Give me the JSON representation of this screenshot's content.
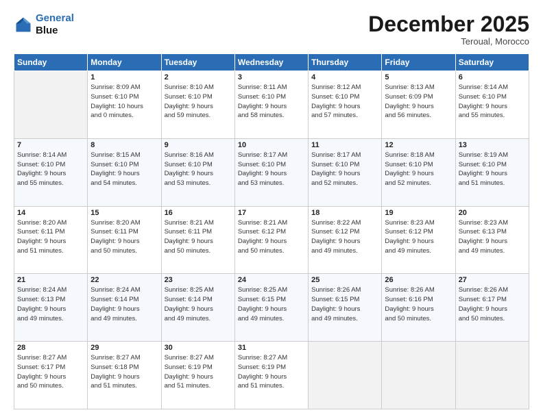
{
  "header": {
    "logo_line1": "General",
    "logo_line2": "Blue",
    "month": "December 2025",
    "location": "Teroual, Morocco"
  },
  "weekdays": [
    "Sunday",
    "Monday",
    "Tuesday",
    "Wednesday",
    "Thursday",
    "Friday",
    "Saturday"
  ],
  "weeks": [
    [
      {
        "day": "",
        "sunrise": "",
        "sunset": "",
        "daylight": ""
      },
      {
        "day": "1",
        "sunrise": "Sunrise: 8:09 AM",
        "sunset": "Sunset: 6:10 PM",
        "daylight": "Daylight: 10 hours and 0 minutes."
      },
      {
        "day": "2",
        "sunrise": "Sunrise: 8:10 AM",
        "sunset": "Sunset: 6:10 PM",
        "daylight": "Daylight: 9 hours and 59 minutes."
      },
      {
        "day": "3",
        "sunrise": "Sunrise: 8:11 AM",
        "sunset": "Sunset: 6:10 PM",
        "daylight": "Daylight: 9 hours and 58 minutes."
      },
      {
        "day": "4",
        "sunrise": "Sunrise: 8:12 AM",
        "sunset": "Sunset: 6:10 PM",
        "daylight": "Daylight: 9 hours and 57 minutes."
      },
      {
        "day": "5",
        "sunrise": "Sunrise: 8:13 AM",
        "sunset": "Sunset: 6:09 PM",
        "daylight": "Daylight: 9 hours and 56 minutes."
      },
      {
        "day": "6",
        "sunrise": "Sunrise: 8:14 AM",
        "sunset": "Sunset: 6:10 PM",
        "daylight": "Daylight: 9 hours and 55 minutes."
      }
    ],
    [
      {
        "day": "7",
        "sunrise": "Sunrise: 8:14 AM",
        "sunset": "Sunset: 6:10 PM",
        "daylight": "Daylight: 9 hours and 55 minutes."
      },
      {
        "day": "8",
        "sunrise": "Sunrise: 8:15 AM",
        "sunset": "Sunset: 6:10 PM",
        "daylight": "Daylight: 9 hours and 54 minutes."
      },
      {
        "day": "9",
        "sunrise": "Sunrise: 8:16 AM",
        "sunset": "Sunset: 6:10 PM",
        "daylight": "Daylight: 9 hours and 53 minutes."
      },
      {
        "day": "10",
        "sunrise": "Sunrise: 8:17 AM",
        "sunset": "Sunset: 6:10 PM",
        "daylight": "Daylight: 9 hours and 53 minutes."
      },
      {
        "day": "11",
        "sunrise": "Sunrise: 8:17 AM",
        "sunset": "Sunset: 6:10 PM",
        "daylight": "Daylight: 9 hours and 52 minutes."
      },
      {
        "day": "12",
        "sunrise": "Sunrise: 8:18 AM",
        "sunset": "Sunset: 6:10 PM",
        "daylight": "Daylight: 9 hours and 52 minutes."
      },
      {
        "day": "13",
        "sunrise": "Sunrise: 8:19 AM",
        "sunset": "Sunset: 6:10 PM",
        "daylight": "Daylight: 9 hours and 51 minutes."
      }
    ],
    [
      {
        "day": "14",
        "sunrise": "Sunrise: 8:20 AM",
        "sunset": "Sunset: 6:11 PM",
        "daylight": "Daylight: 9 hours and 51 minutes."
      },
      {
        "day": "15",
        "sunrise": "Sunrise: 8:20 AM",
        "sunset": "Sunset: 6:11 PM",
        "daylight": "Daylight: 9 hours and 50 minutes."
      },
      {
        "day": "16",
        "sunrise": "Sunrise: 8:21 AM",
        "sunset": "Sunset: 6:11 PM",
        "daylight": "Daylight: 9 hours and 50 minutes."
      },
      {
        "day": "17",
        "sunrise": "Sunrise: 8:21 AM",
        "sunset": "Sunset: 6:12 PM",
        "daylight": "Daylight: 9 hours and 50 minutes."
      },
      {
        "day": "18",
        "sunrise": "Sunrise: 8:22 AM",
        "sunset": "Sunset: 6:12 PM",
        "daylight": "Daylight: 9 hours and 49 minutes."
      },
      {
        "day": "19",
        "sunrise": "Sunrise: 8:23 AM",
        "sunset": "Sunset: 6:12 PM",
        "daylight": "Daylight: 9 hours and 49 minutes."
      },
      {
        "day": "20",
        "sunrise": "Sunrise: 8:23 AM",
        "sunset": "Sunset: 6:13 PM",
        "daylight": "Daylight: 9 hours and 49 minutes."
      }
    ],
    [
      {
        "day": "21",
        "sunrise": "Sunrise: 8:24 AM",
        "sunset": "Sunset: 6:13 PM",
        "daylight": "Daylight: 9 hours and 49 minutes."
      },
      {
        "day": "22",
        "sunrise": "Sunrise: 8:24 AM",
        "sunset": "Sunset: 6:14 PM",
        "daylight": "Daylight: 9 hours and 49 minutes."
      },
      {
        "day": "23",
        "sunrise": "Sunrise: 8:25 AM",
        "sunset": "Sunset: 6:14 PM",
        "daylight": "Daylight: 9 hours and 49 minutes."
      },
      {
        "day": "24",
        "sunrise": "Sunrise: 8:25 AM",
        "sunset": "Sunset: 6:15 PM",
        "daylight": "Daylight: 9 hours and 49 minutes."
      },
      {
        "day": "25",
        "sunrise": "Sunrise: 8:26 AM",
        "sunset": "Sunset: 6:15 PM",
        "daylight": "Daylight: 9 hours and 49 minutes."
      },
      {
        "day": "26",
        "sunrise": "Sunrise: 8:26 AM",
        "sunset": "Sunset: 6:16 PM",
        "daylight": "Daylight: 9 hours and 50 minutes."
      },
      {
        "day": "27",
        "sunrise": "Sunrise: 8:26 AM",
        "sunset": "Sunset: 6:17 PM",
        "daylight": "Daylight: 9 hours and 50 minutes."
      }
    ],
    [
      {
        "day": "28",
        "sunrise": "Sunrise: 8:27 AM",
        "sunset": "Sunset: 6:17 PM",
        "daylight": "Daylight: 9 hours and 50 minutes."
      },
      {
        "day": "29",
        "sunrise": "Sunrise: 8:27 AM",
        "sunset": "Sunset: 6:18 PM",
        "daylight": "Daylight: 9 hours and 51 minutes."
      },
      {
        "day": "30",
        "sunrise": "Sunrise: 8:27 AM",
        "sunset": "Sunset: 6:19 PM",
        "daylight": "Daylight: 9 hours and 51 minutes."
      },
      {
        "day": "31",
        "sunrise": "Sunrise: 8:27 AM",
        "sunset": "Sunset: 6:19 PM",
        "daylight": "Daylight: 9 hours and 51 minutes."
      },
      {
        "day": "",
        "sunrise": "",
        "sunset": "",
        "daylight": ""
      },
      {
        "day": "",
        "sunrise": "",
        "sunset": "",
        "daylight": ""
      },
      {
        "day": "",
        "sunrise": "",
        "sunset": "",
        "daylight": ""
      }
    ]
  ]
}
